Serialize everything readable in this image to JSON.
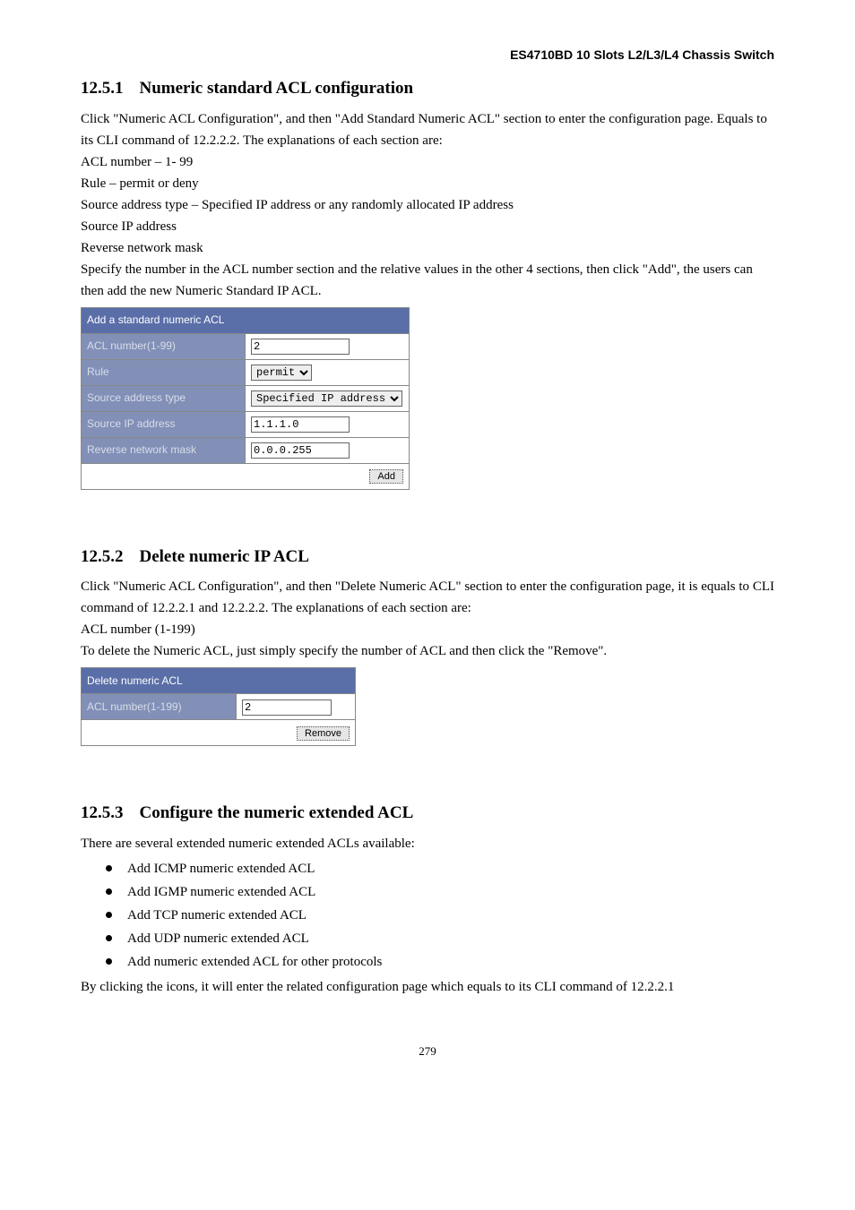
{
  "header": {
    "title": "ES4710BD 10 Slots L2/L3/L4 Chassis Switch"
  },
  "sec1": {
    "num": "12.5.1",
    "title": "Numeric standard ACL configuration",
    "p1": "Click \"Numeric ACL Configuration\", and then \"Add Standard Numeric ACL\" section to enter the configuration page. Equals to its CLI command of 12.2.2.2. The explanations of each section are:",
    "l1": "ACL number – 1- 99",
    "l2": "Rule – permit or deny",
    "l3": "Source address type – Specified IP address or any randomly allocated IP address",
    "l4": "Source IP address",
    "l5": "Reverse network mask",
    "p2": "Specify the number in the ACL number section and the relative values in the other 4 sections, then click \"Add\", the users can then add the new Numeric Standard IP ACL.",
    "form": {
      "caption": "Add a standard numeric ACL",
      "r1_label": "ACL number(1-99)",
      "r1_value": "2",
      "r2_label": "Rule",
      "r2_value": "permit",
      "r3_label": "Source address type",
      "r3_value": "Specified IP address",
      "r4_label": "Source IP address",
      "r4_value": "1.1.1.0",
      "r5_label": "Reverse network mask",
      "r5_value": "0.0.0.255",
      "button": "Add"
    }
  },
  "sec2": {
    "num": "12.5.2",
    "title": "Delete numeric IP ACL",
    "p1": "Click \"Numeric ACL Configuration\", and then \"Delete Numeric ACL\" section to enter the configuration page, it is equals to CLI command of 12.2.2.1 and 12.2.2.2. The explanations of each section are:",
    "l1": "ACL number (1-199)",
    "p2": "To delete the Numeric ACL, just simply specify the number of ACL and then click the \"Remove\".",
    "form": {
      "caption": "Delete numeric ACL",
      "r1_label": "ACL number(1-199)",
      "r1_value": "2",
      "button": "Remove"
    }
  },
  "sec3": {
    "num": "12.5.3",
    "title": "Configure the numeric extended ACL",
    "p1": "There are several extended numeric extended ACLs available:",
    "items": {
      "i1": "Add ICMP numeric extended ACL",
      "i2": "Add IGMP numeric extended ACL",
      "i3": "Add TCP numeric extended ACL",
      "i4": "Add UDP numeric extended ACL",
      "i5": "Add numeric extended ACL for other protocols"
    },
    "p2": "By clicking the icons, it will enter the related configuration page which equals to its CLI command of 12.2.2.1"
  },
  "footer": {
    "page": "279"
  }
}
